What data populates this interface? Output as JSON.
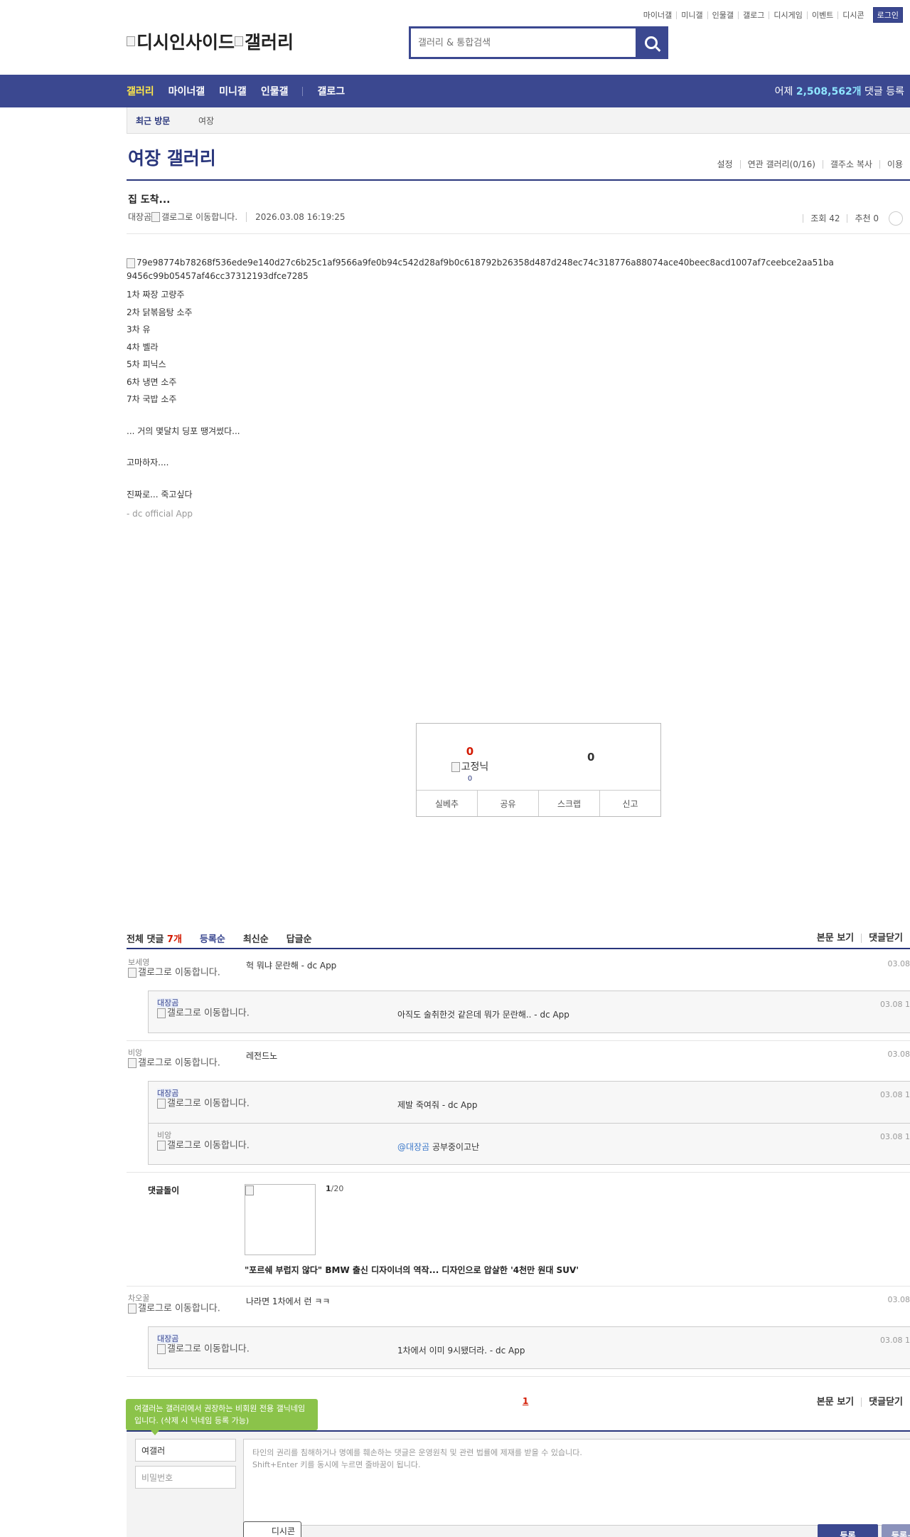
{
  "util_links": [
    "마이너갤",
    "미니갤",
    "인물갤",
    "갤로그",
    "디시게임",
    "이벤트",
    "디시콘"
  ],
  "login_label": "로그인",
  "logo_alt": "디시인사이드",
  "logo_alt2": "갤러리",
  "search": {
    "placeholder": "갤러리 & 통합검색",
    "icon": "search-icon"
  },
  "nav": {
    "items": [
      "갤러리",
      "마이너갤",
      "미니갤",
      "인물갤"
    ],
    "gallog": "갤로그",
    "count_prefix": "어제 ",
    "count_value": "2,508,562개",
    "count_suffix": " 댓글 등록"
  },
  "recent": {
    "label": "최근 방문",
    "item": "여장"
  },
  "gallery": {
    "title": "여장 갤러리",
    "tools": [
      "설정",
      "연관 갤러리(0/16)",
      "갤주소 복사",
      "이용"
    ]
  },
  "post": {
    "title": "집 도착...",
    "author": "대장곰",
    "author_img_alt": "갤로그로 이동합니다.",
    "date": "2026.03.08 16:19:25",
    "views": "조회 42",
    "recommend": "추천 0",
    "image_alt": "79e98774b78268f536ede9e140d27c6b25c1af9566a9fe0b94c542d28af9b0c618792b26358d487d248ec74c318776a88074ace40beec8acd1007af7ceebce2aa51ba9456c99b05457af46cc37312193dfce7285",
    "lines": [
      "1차 짜장 고량주",
      "2차 닭볶음탕 소주",
      "3차 유",
      "4차 벨라",
      "5차 피닉스",
      "6차 냉면 소주",
      "7차 국밥 소주"
    ],
    "p1": "... 거의 몇달치 딩포 땡겨썼다...",
    "p2": "고마하자....",
    "p3": "진짜로... 죽고싶다",
    "footer": "- dc official App"
  },
  "reco": {
    "up_count": "0",
    "fixed_alt": "고정닉",
    "fixed_count": "0",
    "down_count": "0",
    "buttons": [
      "실베추",
      "공유",
      "스크랩",
      "신고"
    ]
  },
  "comments_header": {
    "total_label": "전체 댓글 ",
    "total_count": "7개",
    "sorts": [
      "등록순",
      "최신순",
      "답글순"
    ],
    "right": [
      "본문 보기",
      "댓글닫기"
    ]
  },
  "comments": [
    {
      "nick": "보세영",
      "img_alt": "갤로그로 이동합니다.",
      "text": "헉 뭐냐 문란해 - dc App",
      "date": "03.08",
      "replies": [
        {
          "nick": "대장곰",
          "img_alt": "갤로그로 이동합니다.",
          "text": "아직도 술취한것 같은데 뭐가 문란해.. - dc App",
          "date": "03.08 1"
        }
      ]
    },
    {
      "nick": "비앙",
      "img_alt": "갤로그로 이동합니다.",
      "text": "레전드노",
      "date": "03.08",
      "replies": [
        {
          "nick": "대장곰",
          "img_alt": "갤로그로 이동합니다.",
          "text": "제발 죽여줘 - dc App",
          "date": "03.08 1"
        },
        {
          "nick": "비앙",
          "img_alt": "갤로그로 이동합니다.",
          "at": "@대장곰",
          "text": " 공부중이고난",
          "date": "03.08 1"
        }
      ]
    }
  ],
  "dolgi": {
    "label": "댓글돌이",
    "page_current": "1",
    "page_total": "/20",
    "headline": "\"포르쉐 부럽지 않다\" BMW 출신 디자이너의 역작... 디자인으로 압살한 '4천만 원대 SUV'"
  },
  "comment3": {
    "nick": "차오꿀",
    "img_alt": "갤로그로 이동합니다.",
    "text": "나라면 1차에서 런 ㅋㅋ",
    "date": "03.08",
    "reply": {
      "nick": "대장곰",
      "img_alt": "갤로그로 이동합니다.",
      "text": "1차에서 이미 9시됐더라. - dc App",
      "date": "03.08 1"
    }
  },
  "pager": "1",
  "footer_right": [
    "본문 보기",
    "댓글닫기"
  ],
  "tooltip": "여갤러는 갤러리에서 권장하는 비회원 전용 갤닉네임입니다. (삭제 시 닉네임 등록 가능)",
  "write": {
    "nick_value": "여갤러",
    "password_placeholder": "비밀번호",
    "textarea_line1": "타인의 권리를 침해하거나 명예를 훼손하는 댓글은 운영원칙 및 관련 법률에 제재를 받을 수 있습니다.",
    "textarea_line2": "Shift+Enter 키를 동시에 누르면 줄바꿈이 됩니다.",
    "dccon": "디시콘",
    "submit": "등록",
    "submit2": "등록+"
  },
  "colors": {
    "brand": "#3b4890",
    "accent_red": "#d31900",
    "active_nav": "#ffe84a",
    "tooltip": "#8bc34a"
  }
}
